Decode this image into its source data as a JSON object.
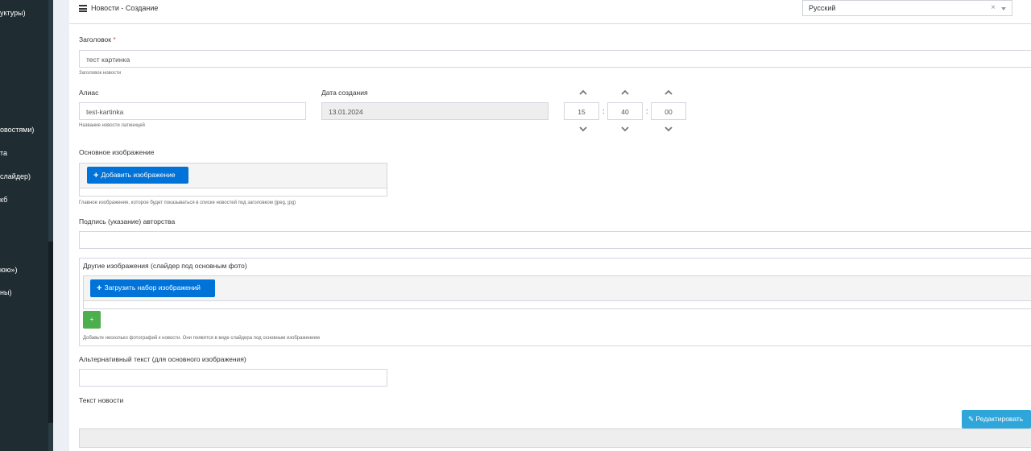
{
  "sidebar": {
    "items": [
      {
        "label": "уктуры)"
      },
      {
        "label": "овостями)"
      },
      {
        "label": "та"
      },
      {
        "label": "слайдер)"
      },
      {
        "label": "кб"
      },
      {
        "label": "юю»)"
      },
      {
        "label": "ны)"
      }
    ]
  },
  "header": {
    "title": "Новости - Создание",
    "language": {
      "selected": "Русский",
      "clear": "×"
    }
  },
  "form": {
    "title": {
      "label": "Заголовок",
      "required_mark": "*",
      "value": "тест картинка",
      "help": "Заголовок новости"
    },
    "alias": {
      "label": "Алиас",
      "value": "test-kartinka",
      "help": "Название новости латиницей"
    },
    "created": {
      "label": "Дата создания",
      "date": "13.01.2024",
      "hours": "15",
      "minutes": "40",
      "seconds": "00",
      "separator": ":"
    },
    "main_image": {
      "label": "Основное изображение",
      "button": "Добавить изображение",
      "help": "Главное изображение, которое будет показываться в списке новостей под заголовком (jpeg, jpg)"
    },
    "author": {
      "label": "Подпись (указание) авторства",
      "value": ""
    },
    "other_images": {
      "label": "Другие изображения (слайдер под основным фото)",
      "button": "Загрузить набор изображений",
      "add": "+",
      "help": "Добавьте несколько фотографий к новости. Они появятся в виде слайдера под основным изображением"
    },
    "alt_text": {
      "label": "Альтернативный текст (для основного изображения)",
      "value": ""
    },
    "body": {
      "label": "Текст новости",
      "edit_button": "Редактировать"
    }
  },
  "colors": {
    "primary": "#0073d9",
    "success": "#4cae4c",
    "info": "#2ea6d9",
    "sidebar": "#1f2c32",
    "required": "#dd4b39"
  }
}
